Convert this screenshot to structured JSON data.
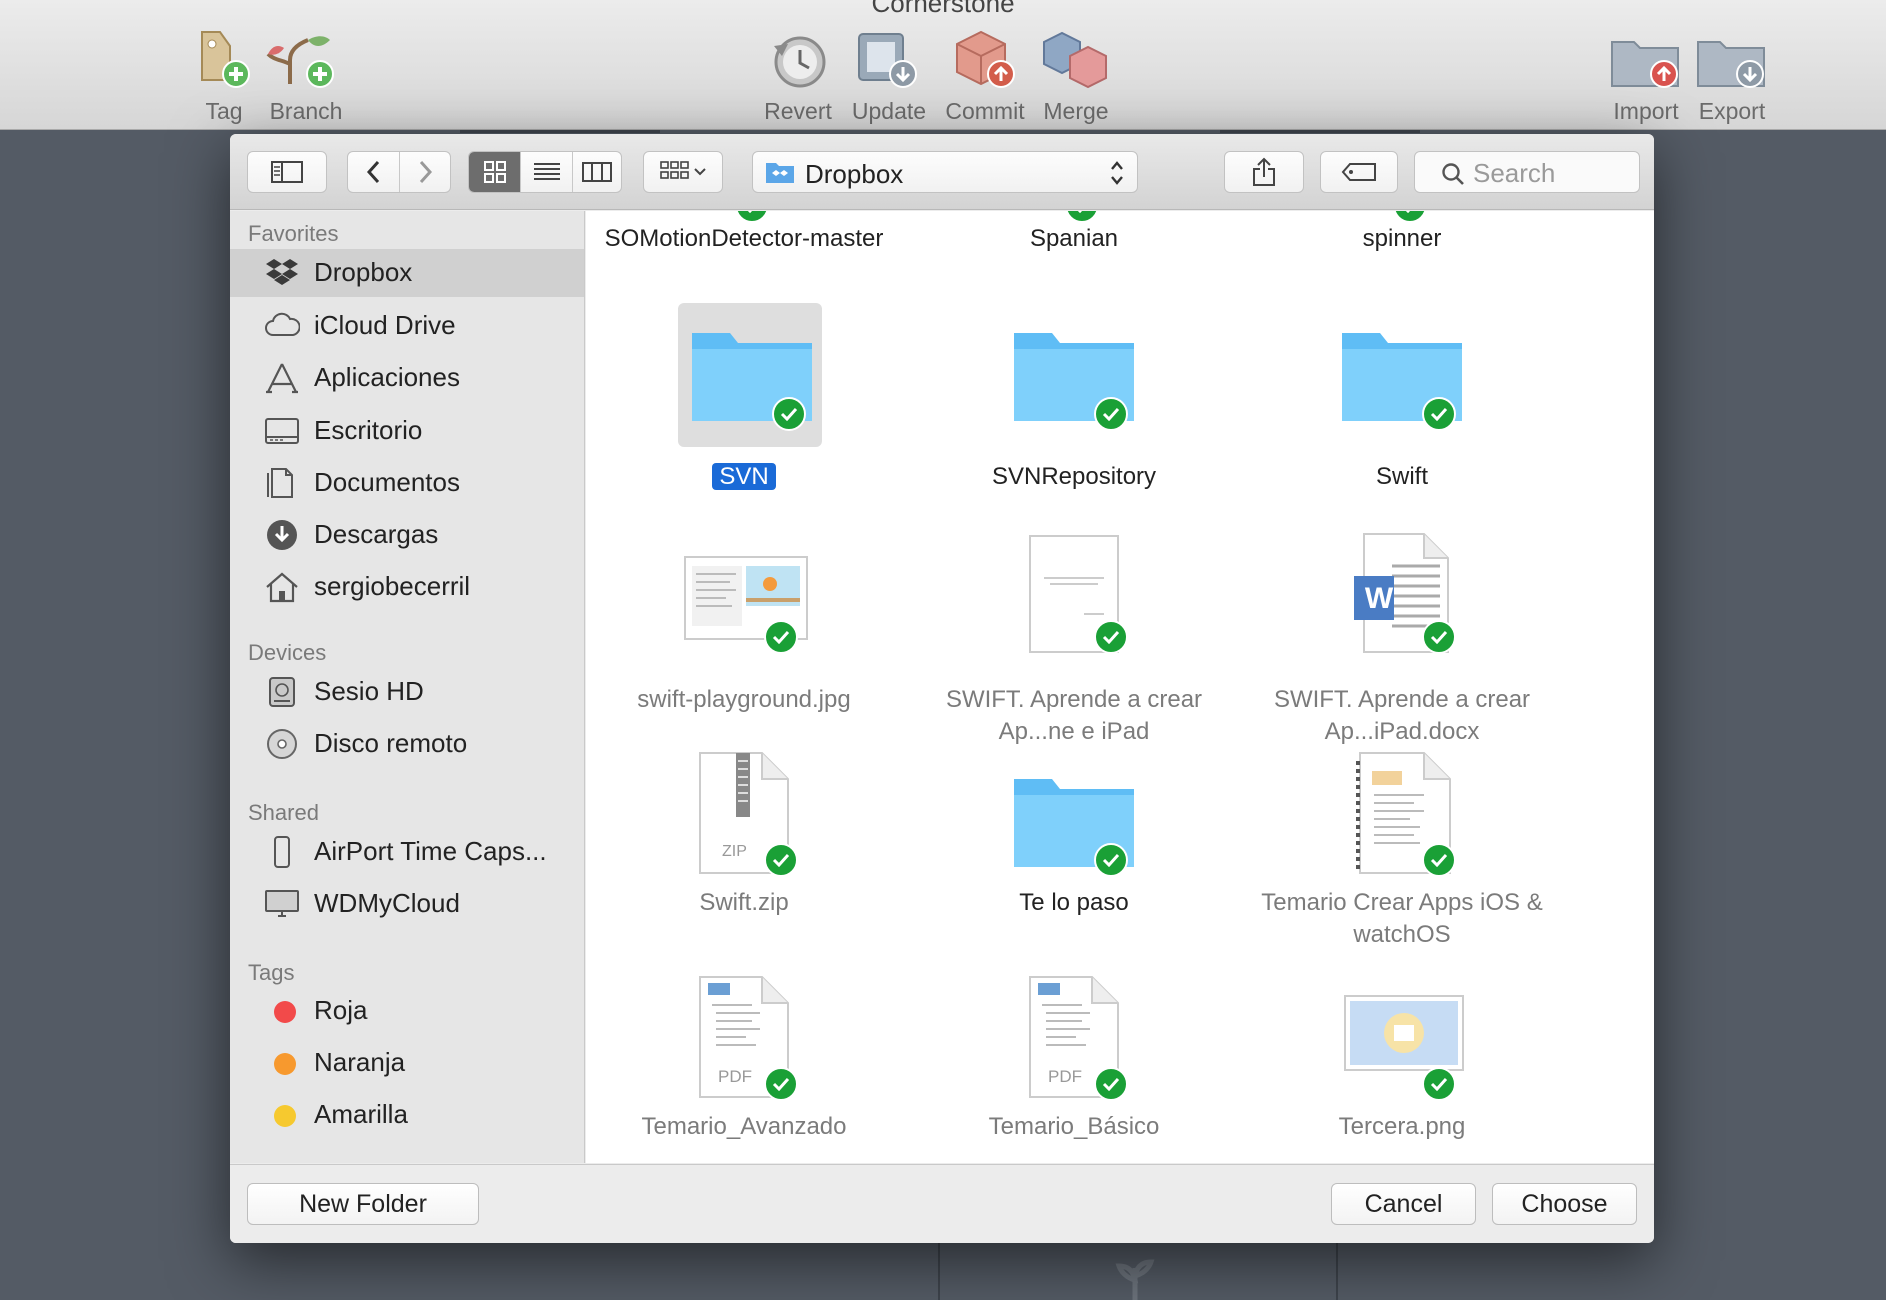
{
  "app": {
    "title": "Cornerstone",
    "toolbar": {
      "tag": "Tag",
      "branch": "Branch",
      "revert": "Revert",
      "update": "Update",
      "commit": "Commit",
      "merge": "Merge",
      "import": "Import",
      "export": "Export"
    }
  },
  "dialog": {
    "path_label": "Dropbox",
    "search_placeholder": "Search",
    "sidebar": {
      "favorites_header": "Favorites",
      "favorites": [
        {
          "label": "Dropbox",
          "icon": "dropbox-icon",
          "selected": true
        },
        {
          "label": "iCloud Drive",
          "icon": "cloud-icon"
        },
        {
          "label": "Aplicaciones",
          "icon": "applications-icon"
        },
        {
          "label": "Escritorio",
          "icon": "desktop-icon"
        },
        {
          "label": "Documentos",
          "icon": "documents-icon"
        },
        {
          "label": "Descargas",
          "icon": "downloads-icon"
        },
        {
          "label": "sergiobecerril",
          "icon": "home-icon"
        }
      ],
      "devices_header": "Devices",
      "devices": [
        {
          "label": "Sesio HD",
          "icon": "hard-drive-icon"
        },
        {
          "label": "Disco remoto",
          "icon": "remote-disc-icon"
        }
      ],
      "shared_header": "Shared",
      "shared": [
        {
          "label": "AirPort Time Caps...",
          "icon": "airport-icon"
        },
        {
          "label": "WDMyCloud",
          "icon": "display-icon"
        }
      ],
      "tags_header": "Tags",
      "tags": [
        {
          "label": "Roja",
          "color": "#f24a4a"
        },
        {
          "label": "Naranja",
          "color": "#f7992e"
        },
        {
          "label": "Amarilla",
          "color": "#f6c92f"
        }
      ]
    },
    "files": [
      {
        "name": "SOMotionDetector-master",
        "kind": "partial"
      },
      {
        "name": "Spanian",
        "kind": "partial"
      },
      {
        "name": "spinner",
        "kind": "partial"
      },
      {
        "name": "SVN",
        "kind": "folder",
        "selected": true
      },
      {
        "name": "SVNRepository",
        "kind": "folder"
      },
      {
        "name": "Swift",
        "kind": "folder"
      },
      {
        "name": "swift-playground.jpg",
        "kind": "image",
        "dim": true
      },
      {
        "name": "SWIFT. Aprende a crear Ap...ne e iPad",
        "kind": "doc",
        "dim": true
      },
      {
        "name": "SWIFT. Aprende a crear Ap...iPad.docx",
        "kind": "word",
        "dim": true
      },
      {
        "name": "Swift.zip",
        "kind": "zip",
        "dim": true
      },
      {
        "name": "Te lo paso",
        "kind": "folder"
      },
      {
        "name": "Temario Crear Apps iOS & watchOS",
        "kind": "book",
        "dim": true
      },
      {
        "name": "Temario_Avanzado",
        "kind": "pdf",
        "dim": true
      },
      {
        "name": "Temario_Básico",
        "kind": "pdf",
        "dim": true
      },
      {
        "name": "Tercera.png",
        "kind": "png",
        "dim": true
      }
    ],
    "zip_label": "ZIP",
    "pdf_label": "PDF",
    "word_letter": "W",
    "new_folder": "New Folder",
    "cancel": "Cancel",
    "choose": "Choose"
  }
}
